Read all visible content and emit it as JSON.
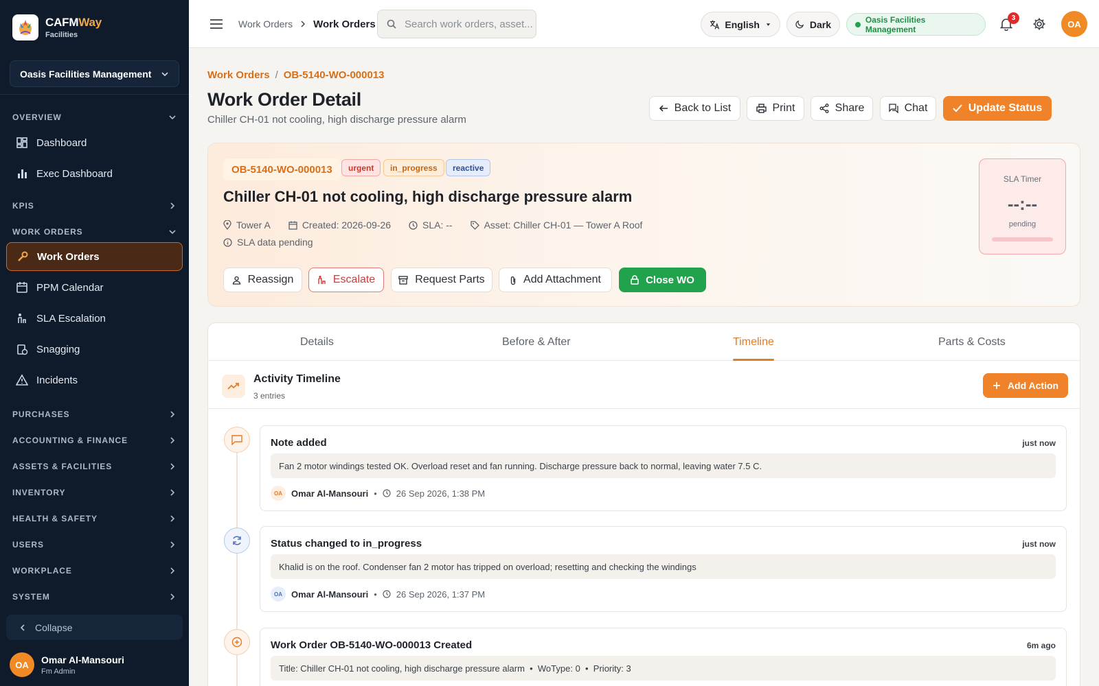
{
  "brand": {
    "name_a": "CAFM",
    "name_b": "Way",
    "sub": "Facilities"
  },
  "org_selector": "Oasis Facilities Management",
  "nav": {
    "overview": "OVERVIEW",
    "dashboard": "Dashboard",
    "exec_dashboard": "Exec Dashboard",
    "kpis": "KPIS",
    "work_orders_section": "WORK ORDERS",
    "work_orders": "Work Orders",
    "ppm_calendar": "PPM Calendar",
    "sla_escalation": "SLA Escalation",
    "snagging": "Snagging",
    "incidents": "Incidents",
    "purchases": "PURCHASES",
    "accounting": "ACCOUNTING & FINANCE",
    "assets": "ASSETS & FACILITIES",
    "inventory": "INVENTORY",
    "health": "HEALTH & SAFETY",
    "users": "USERS",
    "workplace": "WORKPLACE",
    "system": "SYSTEM",
    "collapse": "Collapse"
  },
  "sidebar_user": {
    "initials": "OA",
    "name": "Omar Al-Mansouri",
    "role": "Fm Admin"
  },
  "topbar": {
    "crumb_parent": "Work Orders",
    "crumb_current": "Work Orders",
    "search_placeholder": "Search work orders, asset...",
    "language": "English",
    "theme": "Dark",
    "org_status": "Oasis Facilities Management",
    "notifications": "3",
    "avatar": "OA"
  },
  "page": {
    "crumb_root": "Work Orders",
    "crumb_sep": "/",
    "crumb_code": "OB-5140-WO-000013",
    "title": "Work Order Detail",
    "subtitle": "Chiller CH-01 not cooling, high discharge pressure alarm",
    "actions": {
      "back": "Back to List",
      "print": "Print",
      "share": "Share",
      "chat": "Chat",
      "update": "Update Status"
    }
  },
  "work_order": {
    "code": "OB-5140-WO-000013",
    "badges": {
      "priority": "urgent",
      "status": "in_progress",
      "type": "reactive"
    },
    "title": "Chiller CH-01 not cooling, high discharge pressure alarm",
    "location": "Tower A",
    "created": "Created: 2026-09-26",
    "sla": "SLA: --",
    "asset": "Asset: Chiller CH-01 — Tower A Roof",
    "sla_note": "SLA data pending",
    "buttons": {
      "reassign": "Reassign",
      "escalate": "Escalate",
      "parts": "Request Parts",
      "attach": "Add Attachment",
      "close": "Close WO"
    },
    "sla_timer": {
      "label": "SLA Timer",
      "value": "--:--",
      "state": "pending",
      "progress": 0
    }
  },
  "tabs": {
    "details": "Details",
    "before_after": "Before & After",
    "timeline": "Timeline",
    "parts_costs": "Parts & Costs"
  },
  "timeline": {
    "title": "Activity Timeline",
    "count": "3 entries",
    "add_action": "Add Action",
    "entries": [
      {
        "title": "Note added",
        "time": "just now",
        "body": "Fan 2 motor windings tested OK. Overload reset and fan running. Discharge pressure back to normal, leaving water 7.5 C.",
        "initials": "OA",
        "user": "Omar Al-Mansouri",
        "bullet": "•",
        "datetime": "26 Sep 2026, 1:38 PM"
      },
      {
        "title": "Status changed to in_progress",
        "time": "just now",
        "body": "Khalid is on the roof. Condenser fan 2 motor has tripped on overload; resetting and checking the windings",
        "initials": "OA",
        "user": "Omar Al-Mansouri",
        "bullet": "•",
        "datetime": "26 Sep 2026, 1:37 PM"
      },
      {
        "title": "Work Order OB-5140-WO-000013 Created",
        "time": "6m ago",
        "body": "Title: Chiller CH-01 not cooling, high discharge pressure alarm  •  WoType: 0  •  Priority: 3"
      }
    ]
  },
  "colors": {
    "accent": "#f0822a",
    "sidebar": "#0f1b2b",
    "success": "#23a24d",
    "danger": "#d23b3b"
  }
}
